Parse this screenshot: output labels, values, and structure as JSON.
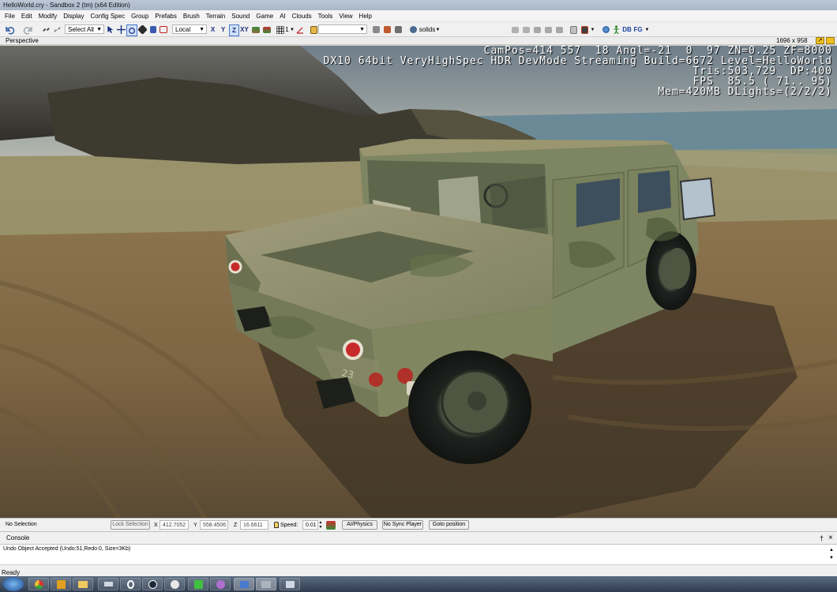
{
  "window": {
    "title": "HelloWorld.cry - Sandbox 2 (tm) (x64 Edition)"
  },
  "menu": [
    "File",
    "Edit",
    "Modify",
    "Display",
    "Config Spec",
    "Group",
    "Prefabs",
    "Brush",
    "Terrain",
    "Sound",
    "Game",
    "AI",
    "Clouds",
    "Tools",
    "View",
    "Help"
  ],
  "toolbar": {
    "select_mode": "Select All",
    "coord_system": "Local",
    "axis_x": "X",
    "axis_y": "Y",
    "axis_z": "Z",
    "axis_xy": "XY",
    "snap_value": "1",
    "render_mode": "solids",
    "db_label": "DB",
    "fg_label": "FG"
  },
  "viewport": {
    "name": "Perspective",
    "resolution": "1696 x 958",
    "hud": [
      "CamPos=414 557  18 Angl=-21  0  97 ZN=0.25 ZF=8000",
      "DX10 64bit VeryHighSpec HDR DevMode Streaming Build=6672 Level=HelloWorld",
      "Tris:503,729  DP:400",
      "FPS  85.5 ( 71.. 95)",
      "Mem=420MB DLights=(2/2/2)"
    ],
    "vehicle_number": "23"
  },
  "status": {
    "selection": "No Selection",
    "lock_selection": "Lock Selection",
    "x_label": "X",
    "x_value": "412.7052",
    "y_label": "Y",
    "y_value": "558.4506",
    "z_label": "Z",
    "z_value": "16.6611",
    "speed_label": "Speed:",
    "speed_value": "0.01",
    "ai_physics": "AI/Physics",
    "no_sync_player": "No Sync Player",
    "goto_position": "Goto position"
  },
  "console": {
    "title": "Console",
    "pin_glyph": "†",
    "close_glyph": "×",
    "output": "Undo Object Accepted (Undo:51,Redo:0, Size=3Kb)"
  },
  "statusbar": {
    "text": "Ready"
  },
  "colors": {
    "sky": "#8c98a2",
    "ground": "#8a7149",
    "vehicle": "#7d8563",
    "hud_text": "#ffffff",
    "taskbar": "#3a4a60"
  }
}
